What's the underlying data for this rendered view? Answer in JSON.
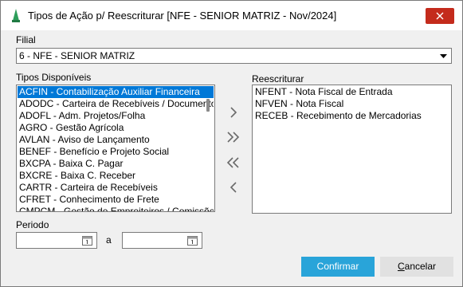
{
  "window": {
    "title": "Tipos de Ação p/ Reescriturar [NFE - SENIOR MATRIZ - Nov/2024]"
  },
  "filial": {
    "label": "Filial",
    "selected": "6 - NFE - SENIOR MATRIZ"
  },
  "available": {
    "label": "Tipos Disponíveis",
    "items": [
      "ACFIN - Contabilização Auxiliar Financeira",
      "ADODC - Carteira de Recebíveis / Documentos",
      "ADOFL - Adm. Projetos/Folha",
      "AGRO - Gestão Agrícola",
      "AVLAN - Aviso de Lançamento",
      "BENEF - Benefício e Projeto Social",
      "BXCPA - Baixa C. Pagar",
      "BXCRE - Baixa C. Receber",
      "CARTR - Carteira de Recebíveis",
      "CFRET - Conhecimento de Frete",
      "CMPCM - Gestão de Empreiteiros / Comissões"
    ],
    "selected_index": 0
  },
  "rewrite": {
    "label": "Reescriturar",
    "items": [
      "NFENT - Nota Fiscal de Entrada",
      "NFVEN - Nota Fiscal",
      "RECEB - Recebimento de Mercadorias"
    ]
  },
  "period": {
    "label": "Periodo",
    "separator": "a",
    "from": "",
    "to": ""
  },
  "buttons": {
    "confirm": "Confirmar",
    "cancel_first": "C",
    "cancel_rest": "ancelar"
  },
  "icons": {
    "move_right": "chevron-right-icon",
    "move_all_right": "double-chevron-right-icon",
    "move_all_left": "double-chevron-left-icon",
    "move_left": "chevron-left-icon"
  },
  "colors": {
    "accent": "#0078d7",
    "confirm": "#29a4d9",
    "close": "#c42b1c"
  }
}
